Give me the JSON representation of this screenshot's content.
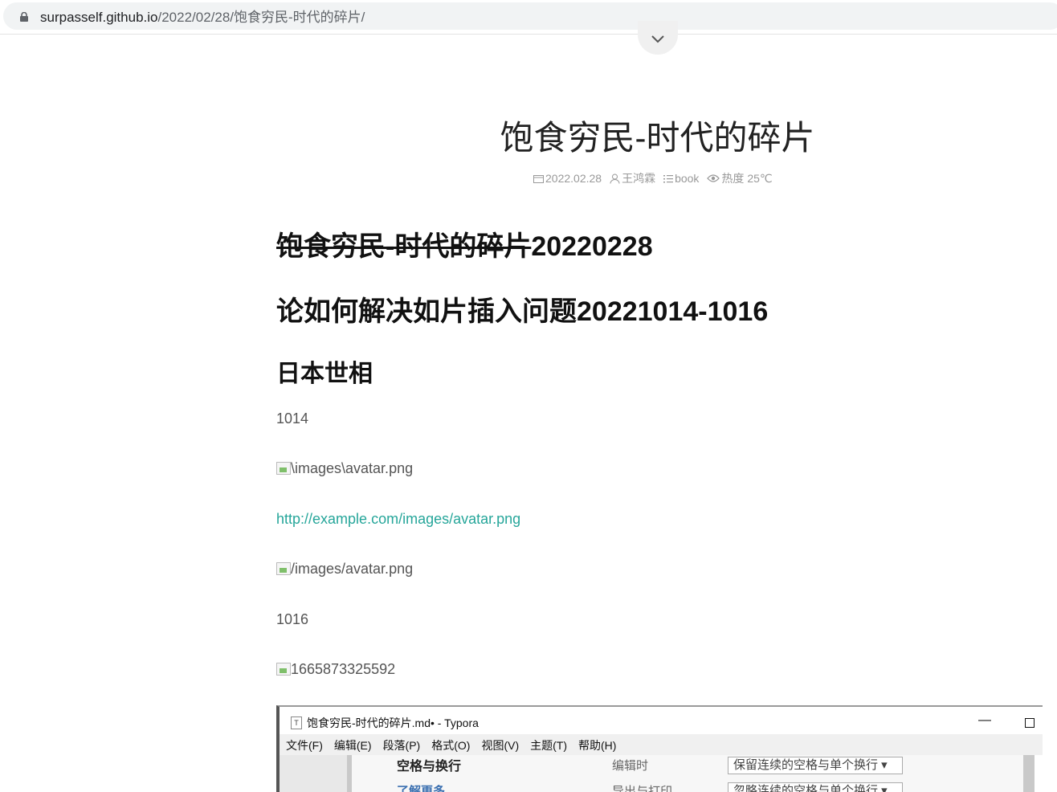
{
  "browser": {
    "url_host": "surpasself.github.io",
    "url_path": "/2022/02/28/饱食穷民-时代的碎片/"
  },
  "post": {
    "title": "饱食穷民-时代的碎片",
    "meta": {
      "date": "2022.02.28",
      "author": "王鸿霖",
      "category": "book",
      "heat": "热度 25℃"
    }
  },
  "content": {
    "h1_strike": "饱食穷民-时代的碎片",
    "h1_suffix": "20220228",
    "h1_second": "论如何解决如片插入问题20221014-1016",
    "h2": "日本世相",
    "p_1014": "1014",
    "img1_alt": "\\images\\avatar.png",
    "link": "http://example.com/images/avatar.png",
    "img2_alt": "/images/avatar.png",
    "p_1016": "1016",
    "img3_alt": "1665873325592"
  },
  "typora": {
    "window_title": "饱食穷民-时代的碎片.md• - Typora",
    "app_icon": "T",
    "minimize": "—",
    "menu": [
      "文件(F)",
      "编辑(E)",
      "段落(P)",
      "格式(O)",
      "视图(V)",
      "主题(T)",
      "帮助(H)"
    ],
    "section_heading": "空格与换行",
    "learn_more": "了解更多",
    "label_edit": "编辑时",
    "label_export": "导出与打印",
    "select_edit": "保留连续的空格与单个换行 ▾",
    "select_export": "忽略连续的空格与单个换行 ▾"
  },
  "colors": {
    "link": "#26a69a",
    "meta": "#999999"
  }
}
